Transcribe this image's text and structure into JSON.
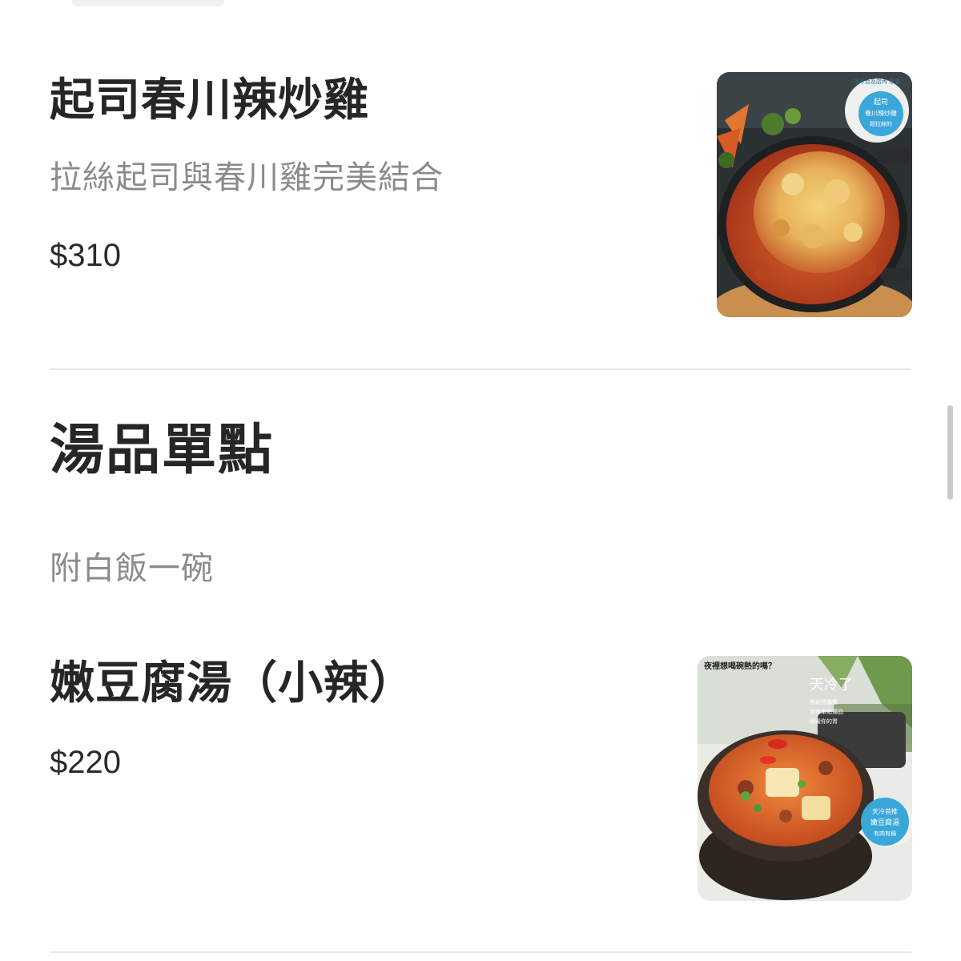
{
  "menu": {
    "items_top": [
      {
        "name": "起司春川辣炒雞",
        "description": "拉絲起司與春川雞完美結合",
        "price": "$310",
        "photo_badge": {
          "arc_text": "限平台及店內 限量",
          "line1": "起司",
          "line2": "春川辣炒雞",
          "line3": "超拉絲的"
        }
      }
    ],
    "section": {
      "title": "湯品單點",
      "note": "附白飯一碗"
    },
    "items_section": [
      {
        "name": "嫩豆腐湯（小辣）",
        "price": "$220",
        "photo_text": {
          "headline": "夜裡想喝碗熱的嗎？",
          "title": "天冷了",
          "sub1": "來碗熱騰騰",
          "sub2": "香辣單點湯品",
          "sub3": "暖暖你的胃",
          "badge1": "天冷首推",
          "badge2": "嫩豆腐湯",
          "badge3": "有肉有鍋"
        }
      }
    ]
  },
  "colors": {
    "accent_badge": "#3aa7d9",
    "text_primary": "#262626",
    "text_secondary": "#8b8b8b",
    "divider": "#e8e8ea"
  }
}
